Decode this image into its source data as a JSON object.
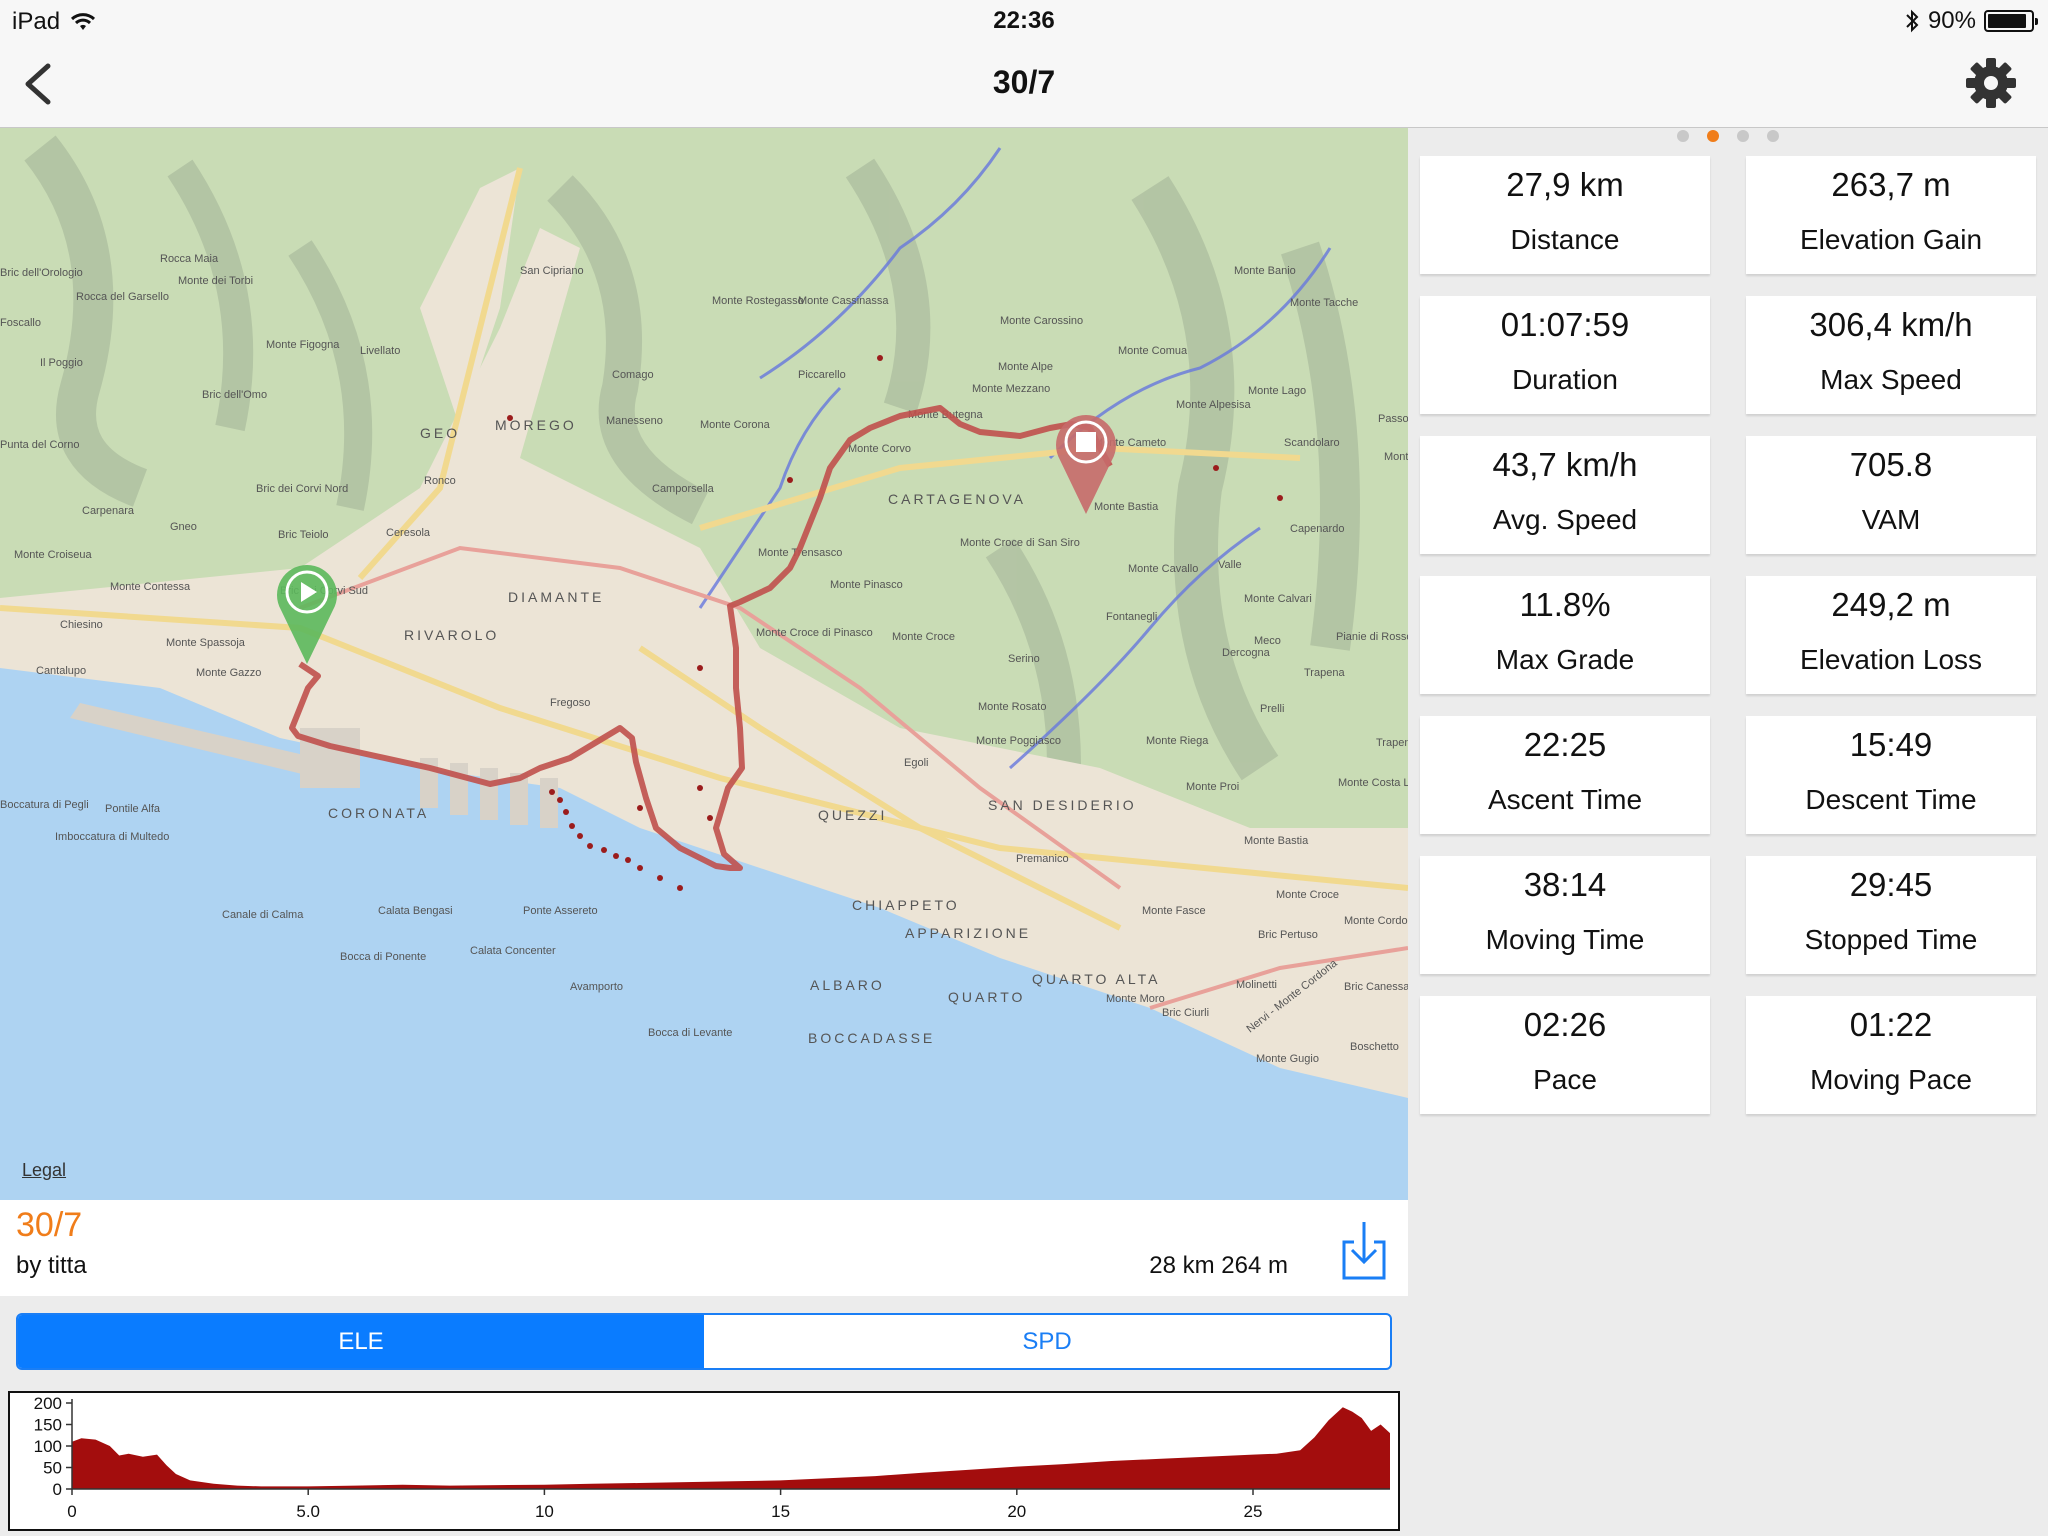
{
  "status_bar": {
    "device": "iPad",
    "time": "22:36",
    "battery": "90%",
    "battery_level": 0.9
  },
  "nav": {
    "title": "30/7"
  },
  "map": {
    "legal": "Legal",
    "labels": [
      "MOREGO",
      "GEO",
      "DIAMANTE",
      "RIVAROLO",
      "CARTAGENOVA",
      "QUEZZI",
      "SAN DESIDERIO",
      "CHIAPPETO",
      "APPARIZIONE",
      "QUARTO ALTA",
      "QUARTO",
      "ALBARO",
      "BOCCADASSE",
      "CORONATA",
      "Fregoso",
      "Calata Bengasi",
      "Ponte Assereto",
      "Calata Concenter",
      "Bocca di Ponente",
      "Canale di Calma",
      "Avamporto",
      "Bocca di Levante",
      "Pontile Alfa",
      "Imboccatura di Multedo",
      "Monte Fasce",
      "Monte Moro",
      "Nervi - Monte Cordona",
      "Serino",
      "Fontanegli",
      "Dercogna",
      "Trapena",
      "Premanico",
      "Egoli",
      "Monte Rosato",
      "Monte Croce",
      "Monte Pinasco",
      "Monte Trensasco",
      "Monte Corvo",
      "Monte Corona",
      "Camporsella",
      "Manesseno",
      "Comago",
      "Piccarello",
      "Monte Carossino",
      "Monte Alpe",
      "Monte Mezzano",
      "Monte Butegna",
      "Monte Cameto",
      "Monte Bastia",
      "Monte Cavallo",
      "Valle",
      "Capenardo",
      "Monte Calvari",
      "Meco",
      "Monte Riega",
      "Monte Proi",
      "Monte Croce",
      "Bric Pertuso",
      "Molinetti",
      "Bric Ciurli",
      "Boschetto",
      "Monte Gugio",
      "Bric Canessa",
      "Monte Lago",
      "Scandolaro",
      "Monte Alpesisa",
      "Monte Comua",
      "Monte Banio",
      "Monte Tacche",
      "Monte Rostegasso",
      "Monte Cassinassa",
      "San Cipriano",
      "Rocca Maia",
      "Monte dei Torbi",
      "Rocca del Garsello",
      "Bric dell'Orologio",
      "Foscallo",
      "Il Poggio",
      "Monte Figogna",
      "Livellato",
      "Bric dell'Omo",
      "Bric dei Corvi Nord",
      "Bric Teiolo",
      "Bric dei Corvi Sud",
      "Ronco",
      "Ceresola",
      "Carpenara",
      "Gneo",
      "Monte Croiseua",
      "Monte Contessa",
      "Chiesino",
      "Monte Spassoja",
      "Monte Gazzo",
      "Cantalupo",
      "Boccatura di Pegli",
      "Prelli",
      "Pianie di Rosso",
      "Trapena Alt",
      "Monte Costa Li",
      "Monte Bastia",
      "Monte Cordo",
      "Monte Croce di San Siro",
      "Monte Poggiasco",
      "Monte Croce di Pinasco",
      "Punta del Corno",
      "Monte Canta",
      "Passo"
    ]
  },
  "track": {
    "name": "30/7",
    "author": "by titta",
    "summary": "28 km 264 m"
  },
  "segments": [
    {
      "label": "ELE",
      "active": true
    },
    {
      "label": "SPD",
      "active": false
    }
  ],
  "chart_data": {
    "type": "area",
    "title": "",
    "xlabel": "",
    "ylabel": "",
    "xlim": [
      0,
      27.9
    ],
    "ylim": [
      0,
      200
    ],
    "x_ticks": [
      "0",
      "5.0",
      "10",
      "15",
      "20",
      "25"
    ],
    "x_tick_values": [
      0,
      5,
      10,
      15,
      20,
      25
    ],
    "y_ticks": [
      "200",
      "150",
      "100",
      "50",
      "0"
    ],
    "y_tick_values": [
      200,
      150,
      100,
      50,
      0
    ],
    "fill_color": "#a30d0d",
    "x": [
      0,
      0.2,
      0.5,
      0.8,
      1.0,
      1.2,
      1.5,
      1.8,
      2.0,
      2.2,
      2.5,
      3.0,
      3.5,
      4.0,
      5.0,
      6.0,
      7.0,
      8.0,
      9.0,
      10.0,
      11.0,
      12.0,
      13.0,
      14.0,
      15.0,
      16.0,
      17.0,
      18.0,
      19.0,
      20.0,
      21.0,
      22.0,
      23.0,
      24.0,
      25.0,
      25.5,
      26.0,
      26.3,
      26.6,
      26.9,
      27.1,
      27.3,
      27.5,
      27.7,
      27.9
    ],
    "y": [
      110,
      118,
      115,
      100,
      78,
      82,
      75,
      80,
      55,
      35,
      20,
      12,
      8,
      6,
      6,
      8,
      10,
      8,
      9,
      10,
      12,
      14,
      16,
      18,
      20,
      25,
      30,
      38,
      45,
      52,
      58,
      65,
      70,
      75,
      80,
      82,
      90,
      120,
      160,
      190,
      180,
      165,
      135,
      150,
      130
    ]
  },
  "stats": [
    {
      "value": "27,9 km",
      "label": "Distance"
    },
    {
      "value": "263,7 m",
      "label": "Elevation Gain"
    },
    {
      "value": "01:07:59",
      "label": "Duration"
    },
    {
      "value": "306,4 km/h",
      "label": "Max Speed"
    },
    {
      "value": "43,7 km/h",
      "label": "Avg. Speed"
    },
    {
      "value": "705.8",
      "label": "VAM"
    },
    {
      "value": "11.8%",
      "label": "Max Grade"
    },
    {
      "value": "249,2 m",
      "label": "Elevation Loss"
    },
    {
      "value": "22:25",
      "label": "Ascent Time"
    },
    {
      "value": "15:49",
      "label": "Descent Time"
    },
    {
      "value": "38:14",
      "label": "Moving Time"
    },
    {
      "value": "29:45",
      "label": "Stopped Time"
    },
    {
      "value": "02:26",
      "label": "Pace"
    },
    {
      "value": "01:22",
      "label": "Moving Pace"
    }
  ],
  "page_dots": {
    "count": 4,
    "active": 1
  },
  "colors": {
    "accent": "#f07d1a",
    "tint": "#0a7cff",
    "route": "#c0504d",
    "start_pin": "#5cb85c",
    "end_pin": "#c66a6a",
    "sea": "#aed3f2"
  }
}
